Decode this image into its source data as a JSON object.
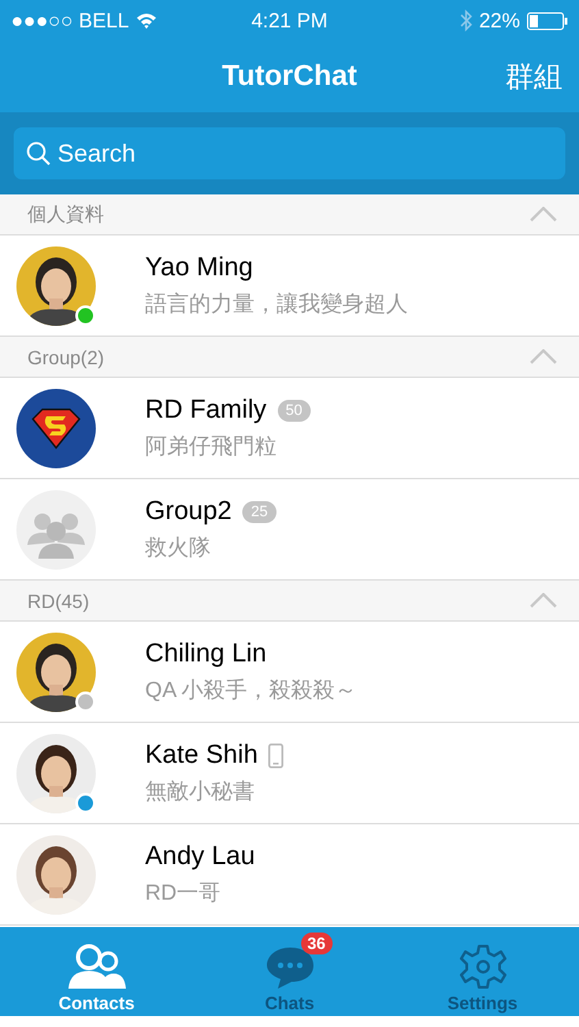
{
  "status_bar": {
    "carrier": "●●●○○ BELL",
    "time": "4:21 PM",
    "battery": "22%"
  },
  "nav": {
    "title": "TutorChat",
    "action": "群組"
  },
  "search": {
    "placeholder": "Search"
  },
  "sections": [
    {
      "title": "個人資料",
      "expanded": true,
      "rows": [
        {
          "name": "Yao Ming",
          "subtitle": "語言的力量，讓我變身超人",
          "kind": "picture",
          "color": "#22c322",
          "mobile": false
        }
      ]
    },
    {
      "title": "Group(2)",
      "expanded": true,
      "rows": [
        {
          "name": "RD Family",
          "subtitle": "阿弟仔飛門粒",
          "kind": "emblem",
          "count": "50",
          "mobile": false
        },
        {
          "name": "Group2",
          "subtitle": "救火隊",
          "kind": "group",
          "count": "25",
          "mobile": false
        }
      ]
    },
    {
      "title": "RD(45)",
      "expanded": true,
      "rows": [
        {
          "name": "Chiling Lin",
          "subtitle": "QA 小殺手，殺殺殺～",
          "kind": "picture",
          "color": "#c0c0c0",
          "mobile": false
        },
        {
          "name": "Kate Shih",
          "subtitle": "無敵小秘書",
          "kind": "picture",
          "color": "#1a9ad8",
          "mobile": true
        },
        {
          "name": "Andy Lau",
          "subtitle": "RD一哥",
          "kind": "picture",
          "mobile": false
        }
      ]
    }
  ],
  "tabs": [
    {
      "label": "Contacts",
      "kind": "contacts",
      "selected": true
    },
    {
      "label": "Chats",
      "kind": "chats",
      "selected": false,
      "badge": "36"
    },
    {
      "label": "Settings",
      "kind": "settings",
      "selected": false
    }
  ]
}
